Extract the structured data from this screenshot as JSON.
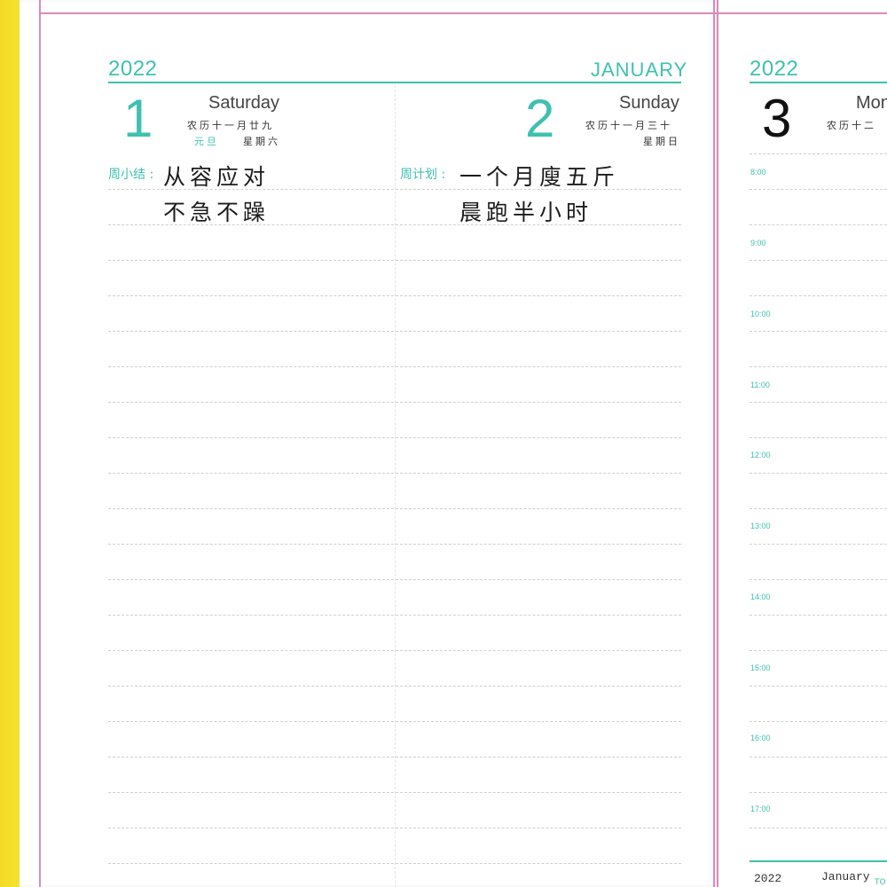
{
  "left_page": {
    "year": "2022",
    "month": "JANUARY",
    "days": [
      {
        "number": "1",
        "weekday": "Saturday",
        "lunar_date": "农历十一月廿九",
        "holiday": "元旦",
        "weekday_cn": "星期六",
        "section_label": "周小结 :",
        "notes": [
          "从容应对",
          "不急不躁"
        ]
      },
      {
        "number": "2",
        "weekday": "Sunday",
        "lunar_date": "农历十一月三十",
        "weekday_cn": "星期日",
        "section_label": "周计划 :",
        "notes": [
          "一个月廋五斤",
          "晨跑半小时"
        ]
      }
    ]
  },
  "right_page": {
    "year": "2022",
    "day": {
      "number": "3",
      "weekday_partial": "Mon",
      "lunar_partial": "农历十二"
    },
    "times": [
      "8:00",
      "9:00",
      "10:00",
      "11:00",
      "12:00",
      "13:00",
      "14:00",
      "15:00",
      "16:00",
      "17:00"
    ],
    "footer": {
      "year": "2022",
      "month": "January",
      "extra": "TO"
    }
  },
  "colors": {
    "accent": "#3ec1b0",
    "margin": "#d98bb8",
    "cover": "#f7d21e"
  }
}
